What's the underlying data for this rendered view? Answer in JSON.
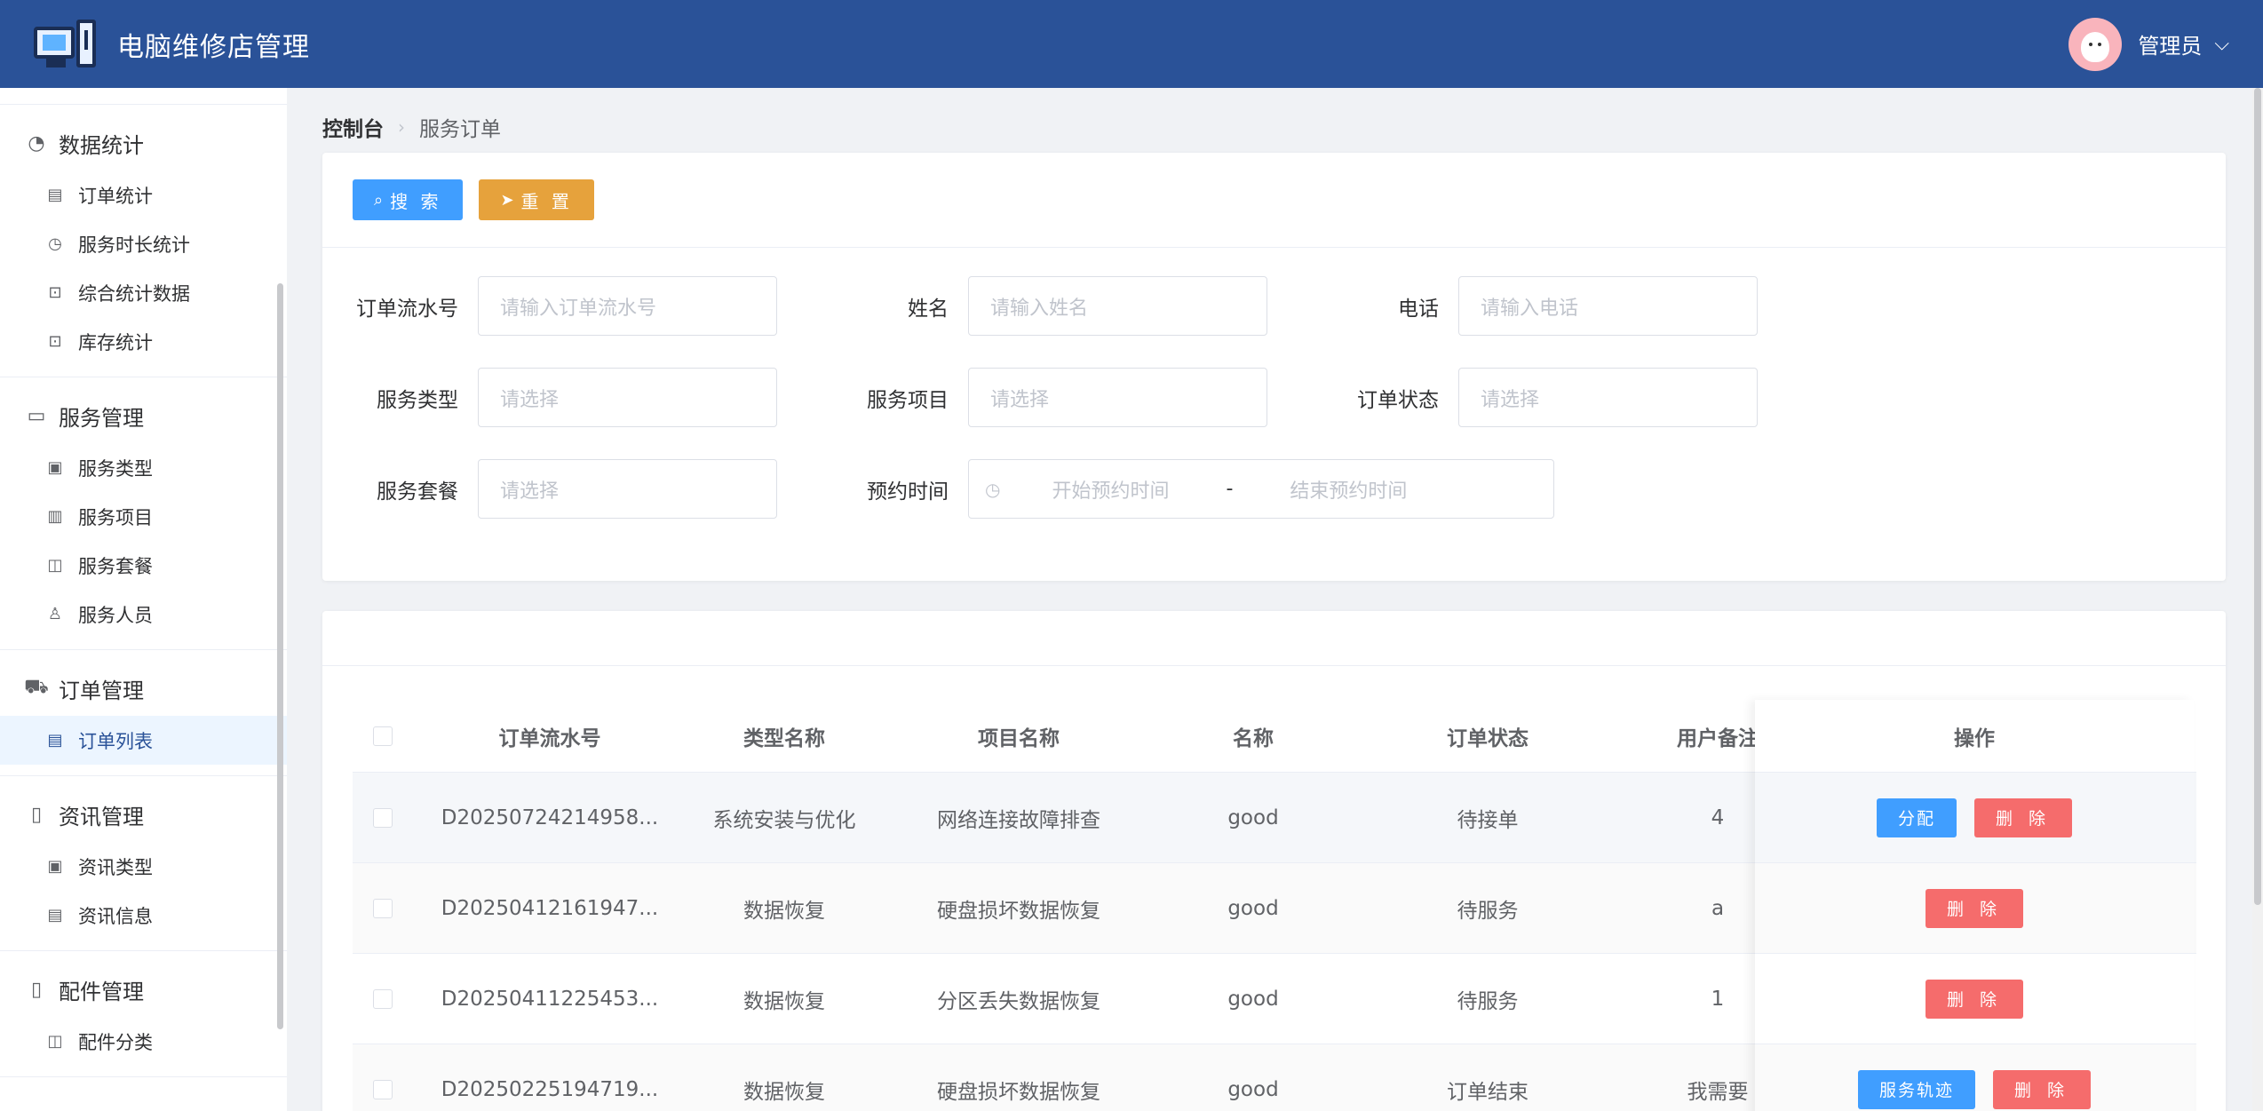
{
  "header": {
    "title": "电脑维修店管理",
    "user_name": "管理员"
  },
  "sidebar": {
    "groups": [
      {
        "label": "数据统计",
        "icon": "pie-chart-icon",
        "items": [
          {
            "label": "订单统计",
            "icon": "document-icon"
          },
          {
            "label": "服务时长统计",
            "icon": "stopwatch-icon"
          },
          {
            "label": "综合统计数据",
            "icon": "chart-icon"
          },
          {
            "label": "库存统计",
            "icon": "chart-icon"
          }
        ]
      },
      {
        "label": "服务管理",
        "icon": "briefcase-icon",
        "items": [
          {
            "label": "服务类型",
            "icon": "notebook-icon"
          },
          {
            "label": "服务项目",
            "icon": "list-icon"
          },
          {
            "label": "服务套餐",
            "icon": "bag-icon"
          },
          {
            "label": "服务人员",
            "icon": "user-icon"
          }
        ]
      },
      {
        "label": "订单管理",
        "icon": "cart-icon",
        "items": [
          {
            "label": "订单列表",
            "icon": "document-icon",
            "active": true
          }
        ]
      },
      {
        "label": "资讯管理",
        "icon": "book-icon",
        "items": [
          {
            "label": "资讯类型",
            "icon": "notebook-icon"
          },
          {
            "label": "资讯信息",
            "icon": "document-icon"
          }
        ]
      },
      {
        "label": "配件管理",
        "icon": "book-icon",
        "items": [
          {
            "label": "配件分类",
            "icon": "bag-icon"
          }
        ]
      }
    ]
  },
  "breadcrumb": {
    "home": "控制台",
    "current": "服务订单"
  },
  "toolbar": {
    "search_label": "搜 索",
    "reset_label": "重 置"
  },
  "form": {
    "order_no": {
      "label": "订单流水号",
      "placeholder": "请输入订单流水号"
    },
    "name": {
      "label": "姓名",
      "placeholder": "请输入姓名"
    },
    "phone": {
      "label": "电话",
      "placeholder": "请输入电话"
    },
    "service_type": {
      "label": "服务类型",
      "placeholder": "请选择"
    },
    "service_item": {
      "label": "服务项目",
      "placeholder": "请选择"
    },
    "order_status": {
      "label": "订单状态",
      "placeholder": "请选择"
    },
    "service_package": {
      "label": "服务套餐",
      "placeholder": "请选择"
    },
    "appointment": {
      "label": "预约时间",
      "start": "开始预约时间",
      "separator": "-",
      "end": "结束预约时间"
    }
  },
  "table": {
    "columns": [
      "订单流水号",
      "类型名称",
      "项目名称",
      "名称",
      "订单状态",
      "用户备注",
      "操作"
    ],
    "rows": [
      {
        "order_no": "D20250724214958...",
        "type": "系统安装与优化",
        "item": "网络连接故障排查",
        "name": "good",
        "status": "待接单",
        "remark": "4",
        "ops": [
          "分配",
          "删 除"
        ]
      },
      {
        "order_no": "D20250412161947...",
        "type": "数据恢复",
        "item": "硬盘损坏数据恢复",
        "name": "good",
        "status": "待服务",
        "remark": "a",
        "ops": [
          "删 除"
        ]
      },
      {
        "order_no": "D20250411225453...",
        "type": "数据恢复",
        "item": "分区丢失数据恢复",
        "name": "good",
        "status": "待服务",
        "remark": "1",
        "ops": [
          "删 除"
        ]
      },
      {
        "order_no": "D20250225194719...",
        "type": "数据恢复",
        "item": "硬盘损坏数据恢复",
        "name": "good",
        "status": "订单结束",
        "remark": "我需要",
        "ops": [
          "服务轨迹",
          "删 除"
        ]
      }
    ]
  },
  "colors": {
    "header_bg": "#2a5298",
    "primary": "#409eff",
    "warning": "#e6a23c",
    "danger": "#f56c6c"
  }
}
